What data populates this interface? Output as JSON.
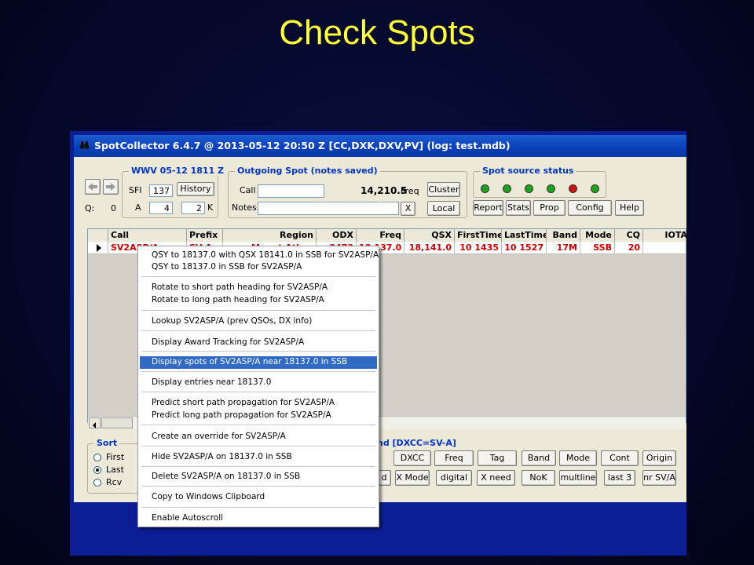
{
  "slide": {
    "title": "Check Spots"
  },
  "window": {
    "title": "SpotCollector 6.4.7 @ 2013-05-12  20:50 Z [CC,DXK,DXV,PV] (log: test.mdb)"
  },
  "wwv": {
    "label": "WWV 05-12 1811 Z",
    "sfi_label": "SFI",
    "sfi_value": "137",
    "history_button": "History",
    "a_label": "A",
    "a_value": "4",
    "k_value": "2",
    "k_label": "K"
  },
  "nav": {
    "q_label": "Q:",
    "q_value": "0"
  },
  "outgoing": {
    "label": "Outgoing Spot (notes saved)",
    "call_label": "Call",
    "call_value": "",
    "freq_value": "14,210.5",
    "freq_label": "Freq",
    "cluster_button": "Cluster",
    "notes_label": "Notes",
    "notes_value": "",
    "clear_button": "X",
    "local_button": "Local"
  },
  "source_status": {
    "label": "Spot source status",
    "leds": [
      "#1aa51a",
      "#1aa51a",
      "#1aa51a",
      "#1aa51a",
      "#d01010",
      "#1aa51a"
    ],
    "buttons": [
      "Report",
      "Stats",
      "Prop",
      "Config",
      "Help"
    ]
  },
  "grid": {
    "columns": [
      "Call",
      "Prefix",
      "Region",
      "ODX",
      "Freq",
      "QSX",
      "FirstTime",
      "LastTime",
      "Band",
      "Mode",
      "CQ",
      "IOTA"
    ],
    "rows": [
      [
        "SV2ASP/A",
        "SV-A",
        "Mount Athos",
        "2473",
        "18,137.0",
        "18,141.0",
        "10 1435",
        "10 1527",
        "17M",
        "SSB",
        "20",
        ""
      ]
    ]
  },
  "bottom": {
    "sort_label": "Sort",
    "sort_options": [
      "First",
      "Last",
      "Rcv"
    ],
    "filter_label": "nd [DXCC=SV-A]",
    "row1_buttons": [
      "DXCC",
      "Freq",
      "Tag",
      "Band",
      "Mode",
      "Cont",
      "Origin"
    ],
    "row2_buttons": [
      "d",
      "X Mode",
      "digital",
      "X need",
      "NoK",
      "multline",
      "last 3",
      "nr SV/A"
    ]
  },
  "context_menu": {
    "items": [
      "QSY to 18137.0 with QSX 18141.0 in SSB for SV2ASP/A",
      "QSY to 18137.0 in SSB for SV2ASP/A",
      "Rotate to short path heading for SV2ASP/A",
      "Rotate to long path heading for SV2ASP/A",
      "Lookup SV2ASP/A (prev QSOs, DX info)",
      "Display Award Tracking for SV2ASP/A",
      "Display spots of SV2ASP/A near 18137.0 in SSB",
      "Display entries near 18137.0",
      "Predict short path propagation for SV2ASP/A",
      "Predict long path propagation for SV2ASP/A",
      "Create an override for SV2ASP/A",
      "Hide SV2ASP/A on 18137.0 in SSB",
      "Delete SV2ASP/A on 18137.0 in SSB",
      "Copy to Windows Clipboard",
      "Enable Autoscroll"
    ],
    "highlighted_item": "Display spots of SV2ASP/A near 18137.0 in SSB"
  }
}
